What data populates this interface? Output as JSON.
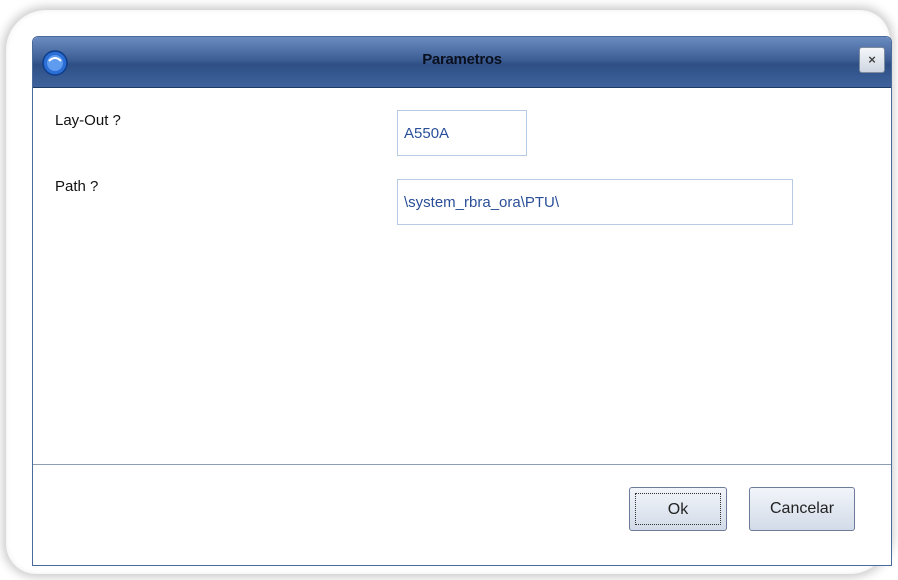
{
  "dialog": {
    "title": "Parametros",
    "close_icon": "close-icon",
    "close_glyph": "×",
    "logo_icon": "app-logo-icon"
  },
  "form": {
    "layout_label": "Lay-Out ?",
    "layout_value": "A550A",
    "path_label": "Path ?",
    "path_value": "\\system_rbra_ora\\PTU\\"
  },
  "footer": {
    "ok_label": "Ok",
    "cancel_label": "Cancelar"
  },
  "colors": {
    "titlebar": "#3d5f96",
    "field_text": "#2a4f98",
    "field_border": "#b8cbe4"
  }
}
